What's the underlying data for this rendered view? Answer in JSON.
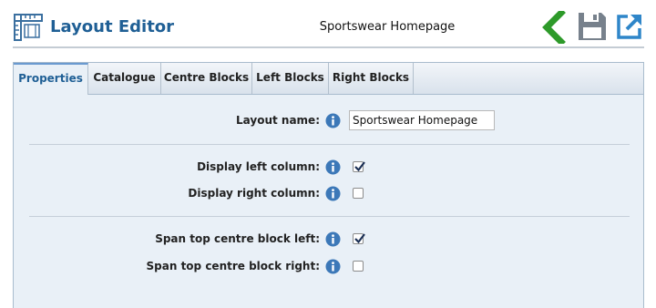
{
  "app": {
    "title": "Layout Editor",
    "document_title": "Sportswear Homepage",
    "icons": {
      "logo": "layout-ruler-icon",
      "back": "back-arrow-icon",
      "save": "floppy-disk-icon",
      "open": "external-link-icon"
    },
    "colors": {
      "accent": "#1f5f95",
      "back_green": "#2e9a2a",
      "save_gray": "#77818c",
      "open_blue": "#2f86c9",
      "info_blue": "#3c78b8"
    }
  },
  "tabs": [
    {
      "label": "Properties",
      "active": true
    },
    {
      "label": "Catalogue",
      "active": false
    },
    {
      "label": "Centre Blocks",
      "active": false
    },
    {
      "label": "Left Blocks",
      "active": false
    },
    {
      "label": "Right Blocks",
      "active": false
    }
  ],
  "form": {
    "layout_name": {
      "label": "Layout name:",
      "value": "Sportswear Homepage"
    },
    "display_left_column": {
      "label": "Display left column:",
      "checked": true
    },
    "display_right_column": {
      "label": "Display right column:",
      "checked": false
    },
    "span_top_centre_left": {
      "label": "Span top centre block left:",
      "checked": true
    },
    "span_top_centre_right": {
      "label": "Span top centre block right:",
      "checked": false
    }
  }
}
